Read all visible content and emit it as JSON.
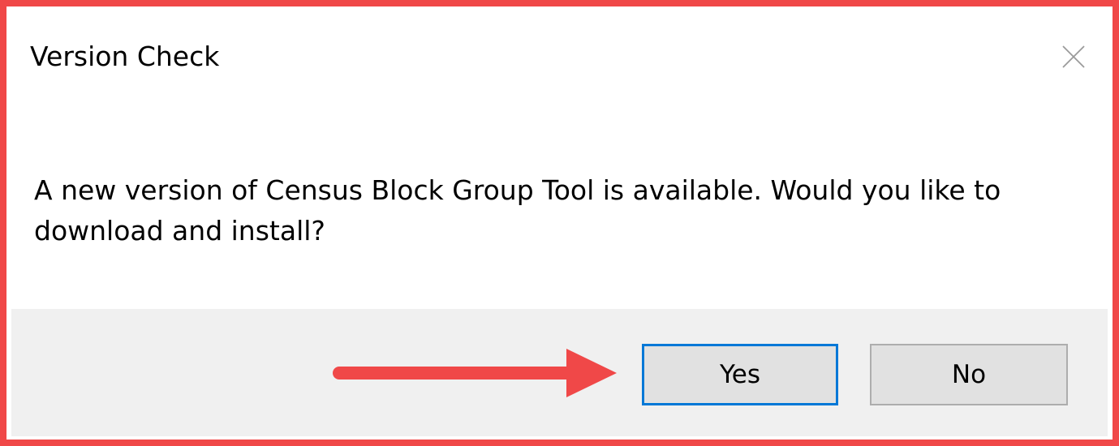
{
  "dialog": {
    "title": "Version Check",
    "message": "A new version of Census Block Group Tool is available. Would you like to download and install?",
    "close_icon": "close-icon",
    "buttons": {
      "yes_label": "Yes",
      "no_label": "No"
    }
  },
  "annotation": {
    "frame_color": "#f04848",
    "arrow_color": "#f04848",
    "arrow_target": "yes-button"
  },
  "colors": {
    "focus_border": "#0078d7",
    "button_bar_bg": "#f0f0f0",
    "button_bg": "#e1e1e1"
  }
}
